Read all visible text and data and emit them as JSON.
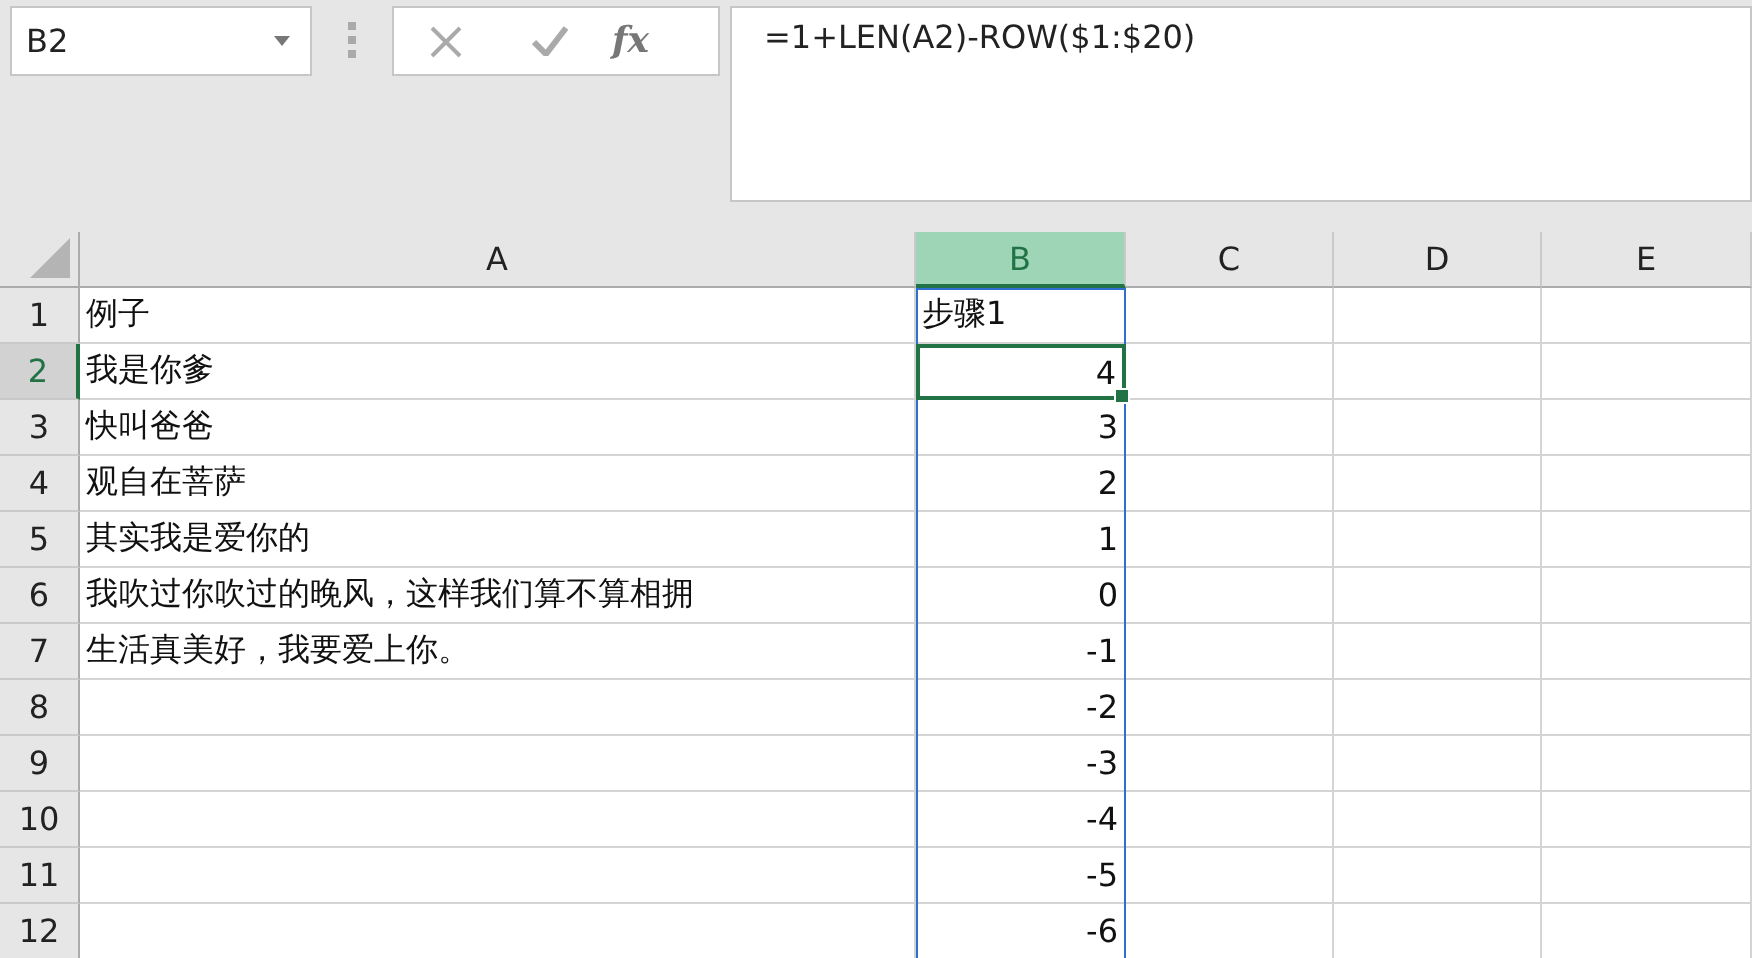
{
  "name_box": {
    "value": "B2"
  },
  "formula_bar": {
    "function_label": "fx",
    "formula": "=1+LEN(A2)-ROW($1:$20)"
  },
  "columns": [
    {
      "label": "A",
      "selected": false,
      "outlined": false
    },
    {
      "label": "B",
      "selected": true,
      "outlined": true
    },
    {
      "label": "C",
      "selected": false,
      "outlined": false
    },
    {
      "label": "D",
      "selected": false,
      "outlined": false
    },
    {
      "label": "E",
      "selected": false,
      "outlined": false
    }
  ],
  "rows": [
    {
      "number": "1",
      "selected": false,
      "col_a": "例子",
      "col_b": {
        "text": "步骤1",
        "kind": "text",
        "active": false
      }
    },
    {
      "number": "2",
      "selected": true,
      "col_a": "我是你爹",
      "col_b": {
        "text": "4",
        "kind": "number",
        "active": true
      }
    },
    {
      "number": "3",
      "selected": false,
      "col_a": "快叫爸爸",
      "col_b": {
        "text": "3",
        "kind": "number",
        "active": false
      }
    },
    {
      "number": "4",
      "selected": false,
      "col_a": "观自在菩萨",
      "col_b": {
        "text": "2",
        "kind": "number",
        "active": false
      }
    },
    {
      "number": "5",
      "selected": false,
      "col_a": "其实我是爱你的",
      "col_b": {
        "text": "1",
        "kind": "number",
        "active": false
      }
    },
    {
      "number": "6",
      "selected": false,
      "col_a": "我吹过你吹过的晚风，这样我们算不算相拥",
      "col_b": {
        "text": "0",
        "kind": "number",
        "active": false
      }
    },
    {
      "number": "7",
      "selected": false,
      "col_a": "生活真美好，我要爱上你。",
      "col_b": {
        "text": "-1",
        "kind": "number",
        "active": false
      }
    },
    {
      "number": "8",
      "selected": false,
      "col_b": {
        "text": "-2",
        "kind": "number",
        "active": false
      }
    },
    {
      "number": "9",
      "selected": false,
      "col_b": {
        "text": "-3",
        "kind": "number",
        "active": false
      }
    },
    {
      "number": "10",
      "selected": false,
      "col_b": {
        "text": "-4",
        "kind": "number",
        "active": false
      }
    },
    {
      "number": "11",
      "selected": false,
      "col_b": {
        "text": "-5",
        "kind": "number",
        "active": false
      }
    },
    {
      "number": "12",
      "selected": false,
      "col_b": {
        "text": "-6",
        "kind": "number",
        "active": false
      }
    }
  ]
}
